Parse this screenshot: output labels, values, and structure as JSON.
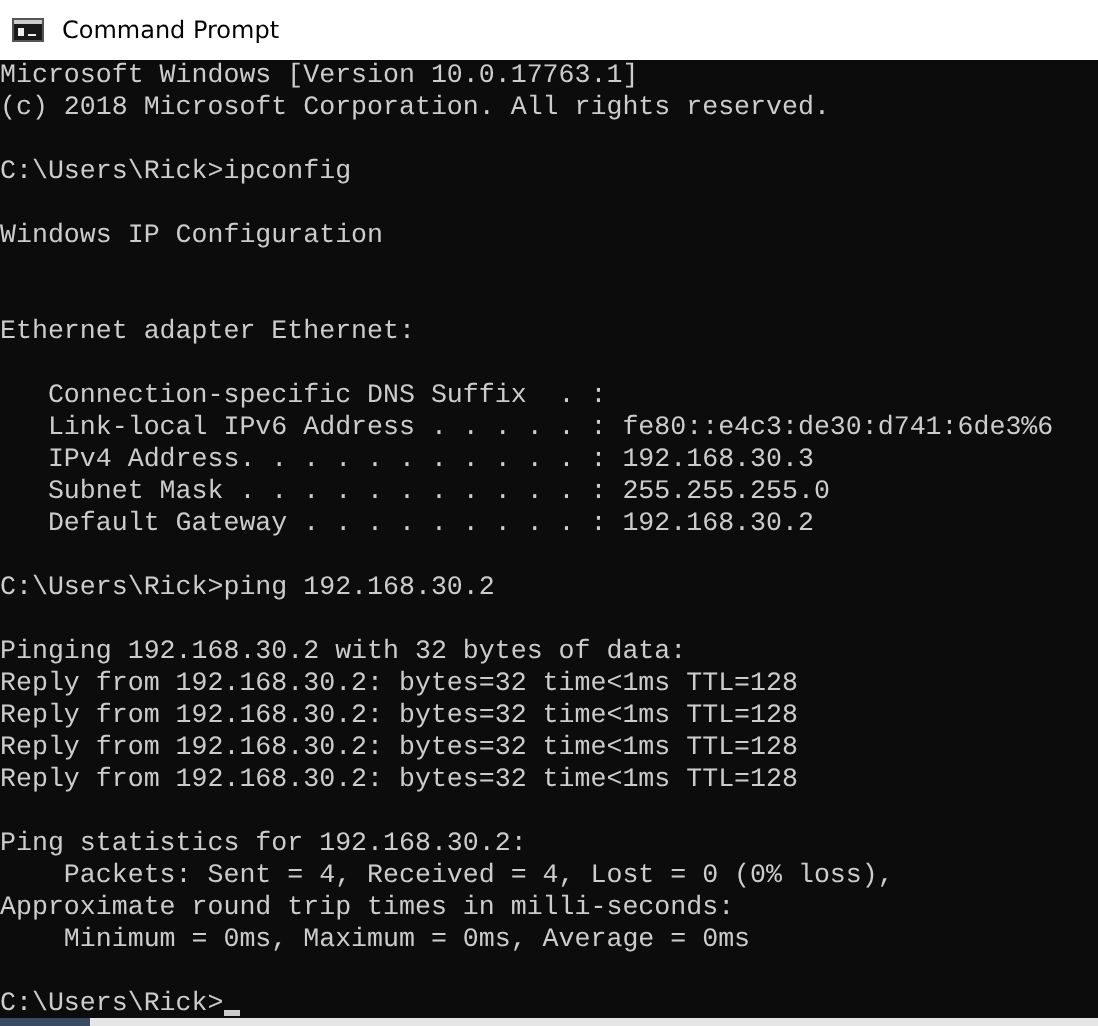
{
  "window": {
    "title": "Command Prompt"
  },
  "console": {
    "lines": [
      {
        "kind": "text",
        "text": "Microsoft Windows [Version 10.0.17763.1]"
      },
      {
        "kind": "text",
        "text": "(c) 2018 Microsoft Corporation. All rights reserved."
      },
      {
        "kind": "blank"
      },
      {
        "kind": "text",
        "text": "C:\\Users\\Rick>ipconfig"
      },
      {
        "kind": "blank"
      },
      {
        "kind": "text",
        "text": "Windows IP Configuration"
      },
      {
        "kind": "blank"
      },
      {
        "kind": "blank"
      },
      {
        "kind": "text",
        "text": "Ethernet adapter Ethernet:"
      },
      {
        "kind": "blank"
      },
      {
        "kind": "text",
        "text": "   Connection-specific DNS Suffix  . :"
      },
      {
        "kind": "text",
        "text": "   Link-local IPv6 Address . . . . . : fe80::e4c3:de30:d741:6de3%6"
      },
      {
        "kind": "text",
        "text": "   IPv4 Address. . . . . . . . . . . : 192.168.30.3"
      },
      {
        "kind": "text",
        "text": "   Subnet Mask . . . . . . . . . . . : 255.255.255.0"
      },
      {
        "kind": "text",
        "text": "   Default Gateway . . . . . . . . . : 192.168.30.2"
      },
      {
        "kind": "blank"
      },
      {
        "kind": "text",
        "text": "C:\\Users\\Rick>ping 192.168.30.2"
      },
      {
        "kind": "blank"
      },
      {
        "kind": "text",
        "text": "Pinging 192.168.30.2 with 32 bytes of data:"
      },
      {
        "kind": "text",
        "text": "Reply from 192.168.30.2: bytes=32 time<1ms TTL=128"
      },
      {
        "kind": "text",
        "text": "Reply from 192.168.30.2: bytes=32 time<1ms TTL=128"
      },
      {
        "kind": "text",
        "text": "Reply from 192.168.30.2: bytes=32 time<1ms TTL=128"
      },
      {
        "kind": "text",
        "text": "Reply from 192.168.30.2: bytes=32 time<1ms TTL=128"
      },
      {
        "kind": "blank"
      },
      {
        "kind": "text",
        "text": "Ping statistics for 192.168.30.2:"
      },
      {
        "kind": "text",
        "text": "    Packets: Sent = 4, Received = 4, Lost = 0 (0% loss),"
      },
      {
        "kind": "text",
        "text": "Approximate round trip times in milli-seconds:"
      },
      {
        "kind": "text",
        "text": "    Minimum = 0ms, Maximum = 0ms, Average = 0ms"
      },
      {
        "kind": "blank"
      }
    ],
    "prompt": {
      "text": "C:\\Users\\Rick>",
      "cursor": true
    }
  }
}
